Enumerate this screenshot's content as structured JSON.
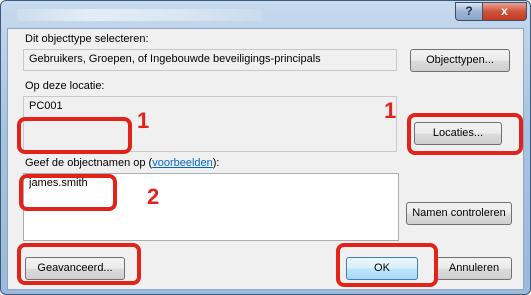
{
  "titlebar": {
    "help_label": "?",
    "close_label": "x"
  },
  "object_type": {
    "label": "Dit objecttype selecteren:",
    "value": "Gebruikers, Groepen, of Ingebouwde beveiligings-principals",
    "button_label": "Objecttypen..."
  },
  "location": {
    "label": "Op deze locatie:",
    "value": "PC001",
    "button_label": "Locaties..."
  },
  "object_names": {
    "label_prefix": "Geef de objectnamen op (",
    "label_link": "voorbeelden",
    "label_suffix": "):",
    "value": "james.smith",
    "check_button_label": "Namen controleren"
  },
  "footer": {
    "advanced_label": "Geavanceerd...",
    "ok_label": "OK",
    "cancel_label": "Annuleren"
  },
  "callouts": {
    "one_a": "1",
    "one_b": "1",
    "two": "2"
  },
  "colors": {
    "highlight": "#e2231a",
    "accent": "#3c7fb1"
  }
}
